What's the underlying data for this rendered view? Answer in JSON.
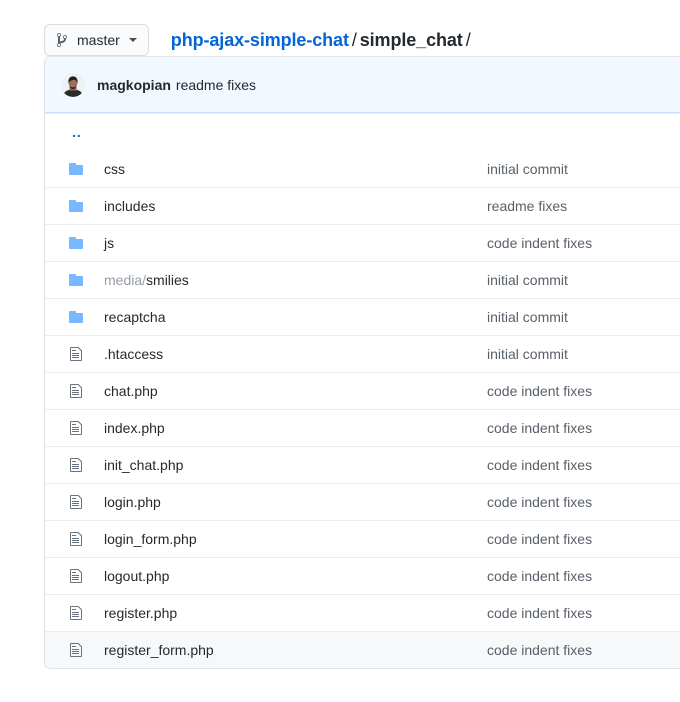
{
  "toolbar": {
    "branch_icon": "git-branch-icon",
    "branch_name": "master",
    "caret_icon": "chevron-down-icon"
  },
  "breadcrumb": {
    "repo": "php-ajax-simple-chat",
    "separator": "/",
    "current": "simple_chat",
    "trailing": "/"
  },
  "commit_header": {
    "avatar_icon": "user-avatar",
    "author": "magkopian",
    "message": "readme fixes"
  },
  "parent_row": {
    "label": ".."
  },
  "rows": [
    {
      "type": "folder",
      "icon": "folder-icon",
      "name": "css",
      "name_prefix": "",
      "commit": "initial commit"
    },
    {
      "type": "folder",
      "icon": "folder-icon",
      "name": "includes",
      "name_prefix": "",
      "commit": "readme fixes"
    },
    {
      "type": "folder",
      "icon": "folder-icon",
      "name": "js",
      "name_prefix": "",
      "commit": "code indent fixes"
    },
    {
      "type": "folder",
      "icon": "folder-icon",
      "name": "smilies",
      "name_prefix": "media/",
      "commit": "initial commit"
    },
    {
      "type": "folder",
      "icon": "folder-icon",
      "name": "recaptcha",
      "name_prefix": "",
      "commit": "initial commit"
    },
    {
      "type": "file",
      "icon": "file-icon",
      "name": ".htaccess",
      "name_prefix": "",
      "commit": "initial commit"
    },
    {
      "type": "file",
      "icon": "file-icon",
      "name": "chat.php",
      "name_prefix": "",
      "commit": "code indent fixes"
    },
    {
      "type": "file",
      "icon": "file-icon",
      "name": "index.php",
      "name_prefix": "",
      "commit": "code indent fixes"
    },
    {
      "type": "file",
      "icon": "file-icon",
      "name": "init_chat.php",
      "name_prefix": "",
      "commit": "code indent fixes"
    },
    {
      "type": "file",
      "icon": "file-icon",
      "name": "login.php",
      "name_prefix": "",
      "commit": "code indent fixes"
    },
    {
      "type": "file",
      "icon": "file-icon",
      "name": "login_form.php",
      "name_prefix": "",
      "commit": "code indent fixes"
    },
    {
      "type": "file",
      "icon": "file-icon",
      "name": "logout.php",
      "name_prefix": "",
      "commit": "code indent fixes"
    },
    {
      "type": "file",
      "icon": "file-icon",
      "name": "register.php",
      "name_prefix": "",
      "commit": "code indent fixes"
    },
    {
      "type": "file",
      "icon": "file-icon",
      "name": "register_form.php",
      "name_prefix": "",
      "commit": "code indent fixes",
      "highlighted": true
    }
  ],
  "colors": {
    "link": "#0366d6",
    "folder": "#79b8ff",
    "file_icon": "#6a737d",
    "text": "#24292e",
    "muted": "#586069",
    "dim": "#959da5",
    "border": "#e1e4e8",
    "row_border": "#eaecef",
    "commit_bg": "#f1f8ff",
    "commit_border": "#c8e1ff",
    "highlight_bg": "#f6f8fa"
  }
}
